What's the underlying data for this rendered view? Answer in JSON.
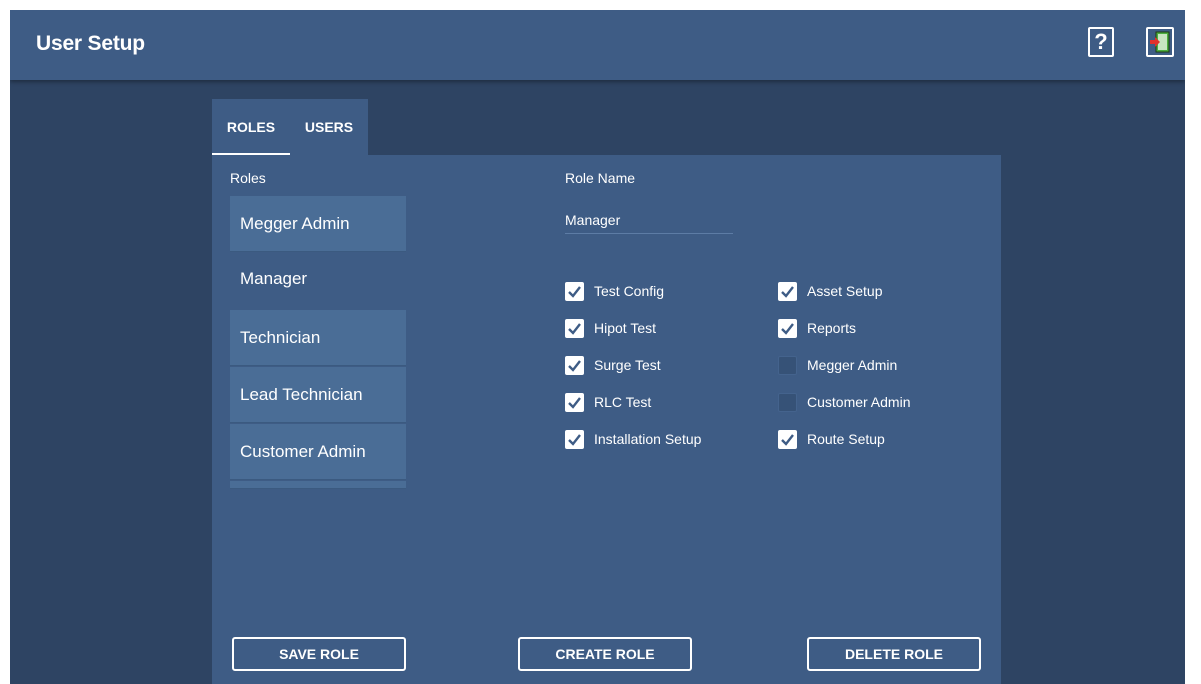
{
  "app": {
    "title": "User Setup"
  },
  "header": {
    "help_label": "?"
  },
  "tabs": [
    {
      "label": "ROLES",
      "active": true
    },
    {
      "label": "USERS",
      "active": false
    }
  ],
  "roles_panel": {
    "list_label": "Roles",
    "items": [
      "Megger Admin",
      "Manager",
      "Technician",
      "Lead Technician",
      "Customer Admin"
    ],
    "selected": "Manager"
  },
  "role_editor": {
    "name_label": "Role Name",
    "name_value": "Manager",
    "permissions": [
      {
        "label": "Test Config",
        "checked": true
      },
      {
        "label": "Hipot Test",
        "checked": true
      },
      {
        "label": "Surge Test",
        "checked": true
      },
      {
        "label": "RLC Test",
        "checked": true
      },
      {
        "label": "Installation Setup",
        "checked": true
      },
      {
        "label": "Asset Setup",
        "checked": true
      },
      {
        "label": "Reports",
        "checked": true
      },
      {
        "label": "Megger Admin",
        "checked": false
      },
      {
        "label": "Customer Admin",
        "checked": false
      },
      {
        "label": "Route Setup",
        "checked": true
      }
    ]
  },
  "actions": {
    "save_label": "SAVE ROLE",
    "create_label": "CREATE ROLE",
    "delete_label": "DELETE ROLE"
  },
  "colors": {
    "header_bg": "#3e5c85",
    "app_bg": "#2e4463",
    "list_item_bg": "#4a6d96",
    "exit_icon_red": "#e0312c",
    "exit_icon_green": "#4caf3e"
  },
  "icons": {
    "help": "help-icon",
    "exit": "exit-door-icon",
    "check": "checkmark-icon"
  }
}
